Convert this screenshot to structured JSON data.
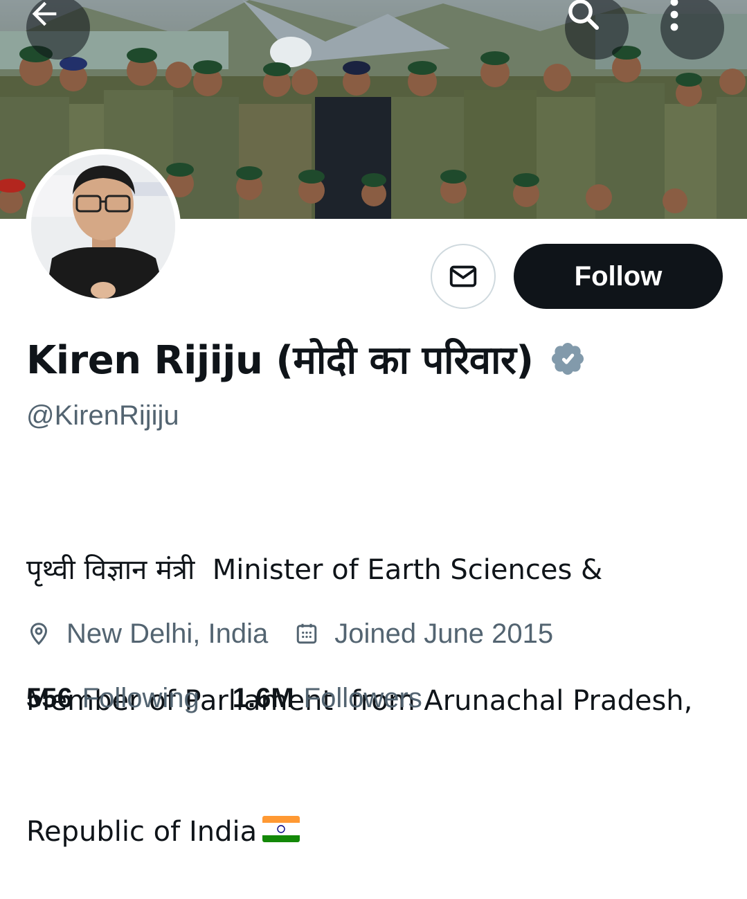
{
  "header": {
    "back_icon": "arrow-left-icon",
    "search_icon": "search-icon",
    "more_icon": "more-vertical-icon"
  },
  "banner": {
    "description_icon": "group-photo-banner"
  },
  "actions": {
    "message_icon": "envelope-icon",
    "follow_label": "Follow"
  },
  "profile": {
    "display_name": "Kiren Rijiju (मोदी का परिवार)",
    "verified_icon": "verified-badge-icon",
    "handle": "@KirenRijiju",
    "bio_lines": [
      "पृथ्वी विज्ञान मंत्री  Minister of Earth Sciences &",
      "Member of Parliament  from Arunachal Pradesh,",
      "Republic of India"
    ],
    "bio_flag_icon": "india-flag-icon",
    "location": "New Delhi, India",
    "joined": "Joined June 2015"
  },
  "stats": {
    "following_count": "556",
    "following_label": "Following",
    "followers_count": "1.6M",
    "followers_label": "Followers"
  },
  "colors": {
    "text_primary": "#0f1419",
    "text_secondary": "#536471",
    "verified_badge": "#829aab",
    "follow_bg": "#0f1419"
  }
}
